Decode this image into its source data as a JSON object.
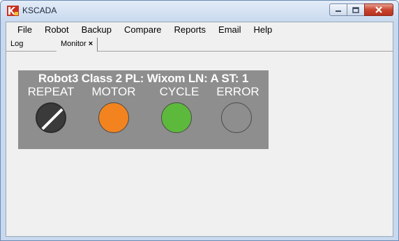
{
  "window": {
    "title": "KSCADA"
  },
  "menu": [
    "File",
    "Robot",
    "Backup",
    "Compare",
    "Reports",
    "Email",
    "Help"
  ],
  "tabs": {
    "log": "Log",
    "monitor": "Monitor",
    "monitor_close": "×"
  },
  "panel": {
    "title": "Robot3 Class 2 PL: Wixom LN: A ST: 1",
    "indicators": {
      "repeat": "REPEAT",
      "motor": "MOTOR",
      "cycle": "CYCLE",
      "error": "ERROR"
    },
    "colors": {
      "motor": "#f3831e",
      "cycle": "#5db93c",
      "error": "#8e8e8e"
    }
  }
}
